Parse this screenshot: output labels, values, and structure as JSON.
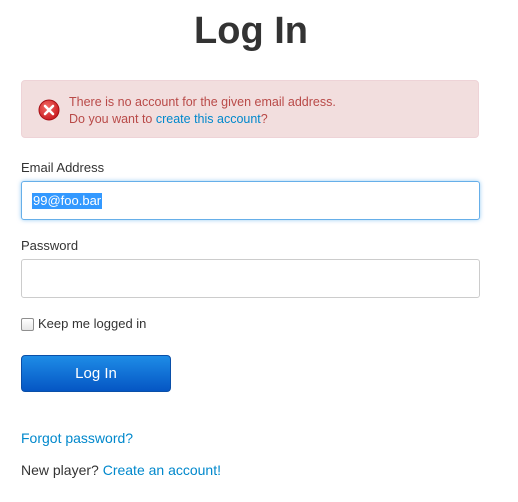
{
  "page": {
    "title": "Log In"
  },
  "alert": {
    "line1": "There is no account for the given email address.",
    "line2_prefix": "Do you want to ",
    "line2_link": "create this account",
    "line2_suffix": "?",
    "icon": "error-x-circle-icon",
    "colors": {
      "background": "#f2dede",
      "text": "#b94a48",
      "icon": "#d9241f"
    }
  },
  "email": {
    "label": "Email Address",
    "value": "99@foo.bar",
    "value_selected": true
  },
  "password": {
    "label": "Password",
    "value": ""
  },
  "remember": {
    "label": "Keep me logged in",
    "checked": false
  },
  "submit": {
    "label": "Log In"
  },
  "links": {
    "forgot": "Forgot password?",
    "new_player_prefix": "New player? ",
    "create_account": "Create an account!"
  },
  "colors": {
    "link": "#0088cc",
    "button": "#0a6cd6"
  }
}
